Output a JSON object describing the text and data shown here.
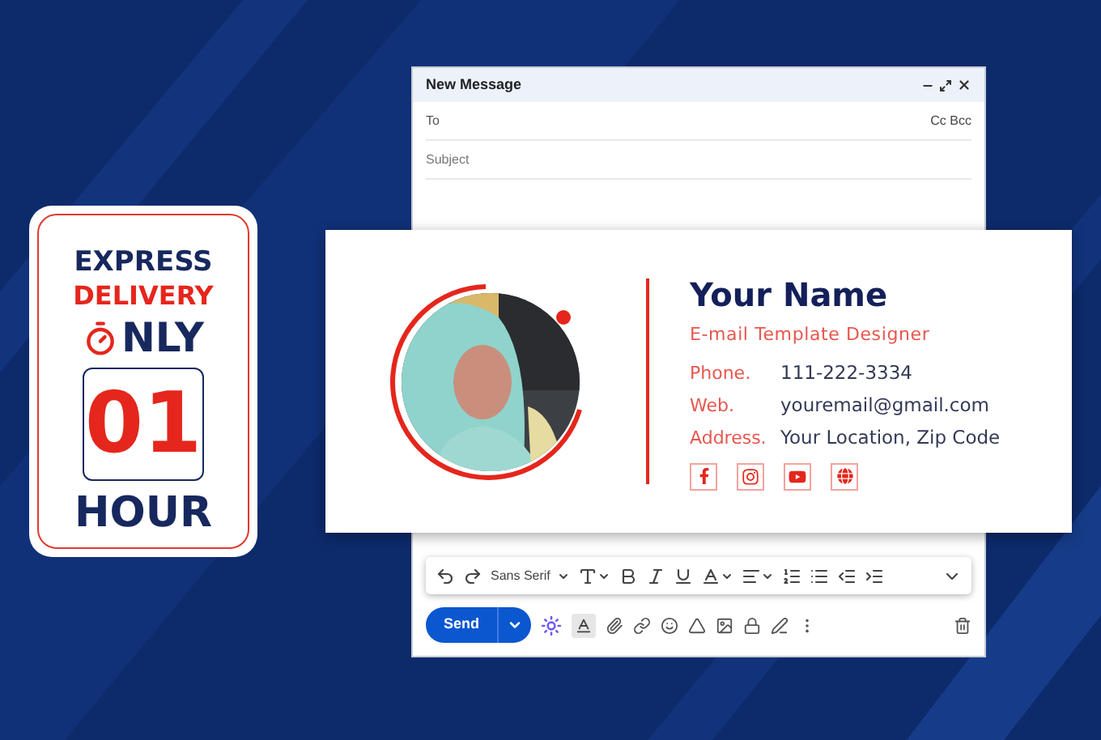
{
  "badge": {
    "line_1": "EXPRESS",
    "line_2": "DELIVERY",
    "only": "NLY",
    "number": "01",
    "unit": "HOUR"
  },
  "compose": {
    "title": "New Message",
    "to_label": "To",
    "cc_bcc": "Cc Bcc",
    "subject": {
      "placeholder": "Subject"
    },
    "font": "Sans Serif",
    "send": "Send"
  },
  "signature": {
    "name": "Your Name",
    "role": "E-mail Template Designer",
    "contacts": [
      {
        "label": "Phone.",
        "value": "111-222-3334"
      },
      {
        "label": "Web.",
        "value": "youremail@gmail.com"
      },
      {
        "label": "Address.",
        "value": "Your Location, Zip Code"
      }
    ]
  }
}
